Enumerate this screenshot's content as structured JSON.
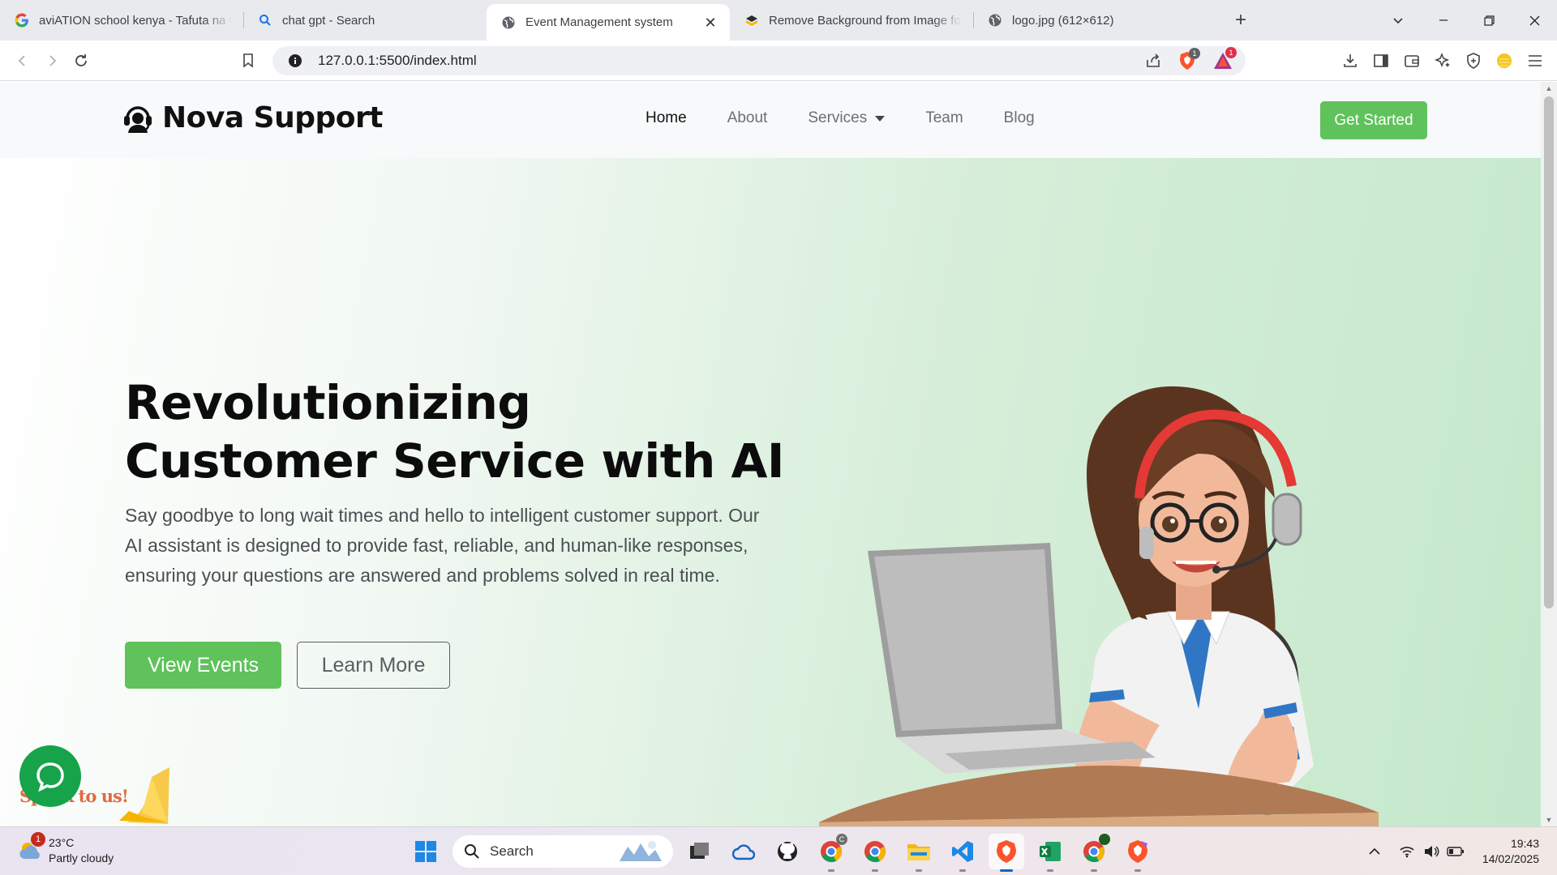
{
  "browser": {
    "tabs": [
      {
        "title": "aviATION school kenya - Tafuta na Google",
        "icon": "google-icon"
      },
      {
        "title": "chat gpt - Search",
        "icon": "search-icon"
      },
      {
        "title": "Event Management system",
        "icon": "globe-icon",
        "active": true
      },
      {
        "title": "Remove Background from Image for Free",
        "icon": "removebg-icon"
      },
      {
        "title": "logo.jpg (612×612)",
        "icon": "globe-icon"
      }
    ],
    "url": "127.0.0.1:5500/index.html",
    "brave_shield_count": "1",
    "rewards_count": "1"
  },
  "site": {
    "brand": "Nova Support",
    "nav": [
      {
        "label": "Home",
        "active": true
      },
      {
        "label": "About"
      },
      {
        "label": "Services",
        "dropdown": true
      },
      {
        "label": "Team"
      },
      {
        "label": "Blog"
      }
    ],
    "cta_label": "Get Started",
    "hero": {
      "title": "Revolutionizing Customer Service with AI",
      "body": "Say goodbye to long wait times and hello to intelligent customer support. Our AI assistant is designed to provide fast, reliable, and human-like responses, ensuring your questions are answered and problems solved in real time.",
      "primary_button": "View Events",
      "secondary_button": "Learn More"
    },
    "chat_widget": {
      "prompt": "Speak to us!"
    },
    "colors": {
      "accent": "#5fc25b",
      "chat": "#16a34a",
      "speak": "#e06a41"
    }
  },
  "taskbar": {
    "weather": {
      "temp": "23°C",
      "condition": "Partly cloudy",
      "badge": "1"
    },
    "search_placeholder": "Search",
    "time": "19:43",
    "date": "14/02/2025"
  }
}
